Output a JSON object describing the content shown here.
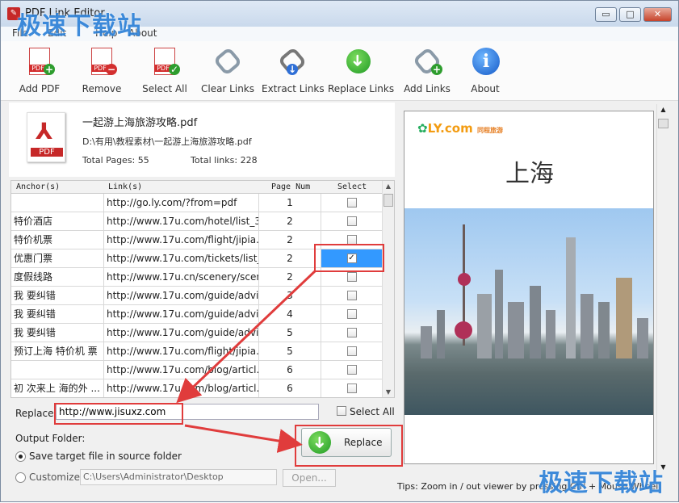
{
  "window": {
    "title": "PDF Link Editor",
    "controls": {
      "minimize": "▭",
      "maximize": "□",
      "close": "✕"
    }
  },
  "watermark": {
    "top": "极速下载站",
    "bottom": "极速下载站"
  },
  "menu": {
    "items": [
      "File",
      "Edit",
      "Help",
      "About"
    ]
  },
  "toolbar": {
    "items": [
      {
        "label": "Add PDF",
        "icon": "add-pdf-icon"
      },
      {
        "label": "Remove",
        "icon": "remove-pdf-icon"
      },
      {
        "label": "Select All",
        "icon": "select-all-icon"
      },
      {
        "label": "Clear Links",
        "icon": "clear-links-icon"
      },
      {
        "label": "Extract Links",
        "icon": "extract-links-icon"
      },
      {
        "label": "Replace Links",
        "icon": "replace-links-icon"
      },
      {
        "label": "Add Links",
        "icon": "add-links-icon"
      },
      {
        "label": "About",
        "icon": "info-icon"
      }
    ]
  },
  "file": {
    "name": "一起游上海旅游攻略.pdf",
    "path": "D:\\有用\\教程素材\\一起游上海旅游攻略.pdf",
    "total_pages": "Total Pages: 55",
    "total_links": "Total links: 228"
  },
  "table": {
    "headers": [
      "Anchor(s)",
      "Link(s)",
      "Page Num",
      "Select"
    ],
    "rows": [
      {
        "anchor": "",
        "link": "http://go.ly.com/?from=pdf",
        "page": "1",
        "selected": false
      },
      {
        "anchor": "特价酒店",
        "link": "http://www.17u.com/hotel/list_3...",
        "page": "2",
        "selected": false
      },
      {
        "anchor": "特价机票",
        "link": "http://www.17u.com/flight/jipia...",
        "page": "2",
        "selected": false
      },
      {
        "anchor": "优惠门票",
        "link": "http://www.17u.com/tickets/list_...",
        "page": "2",
        "selected": true
      },
      {
        "anchor": "度假线路",
        "link": "http://www.17u.cn/scenery/scen...",
        "page": "2",
        "selected": false
      },
      {
        "anchor": "我 要纠错",
        "link": "http://www.17u.com/guide/advi...",
        "page": "3",
        "selected": false
      },
      {
        "anchor": "我 要纠错",
        "link": "http://www.17u.com/guide/advi...",
        "page": "4",
        "selected": false
      },
      {
        "anchor": "我 要纠错",
        "link": "http://www.17u.com/guide/advi...",
        "page": "5",
        "selected": false
      },
      {
        "anchor": "预订上海 特价机 票",
        "link": "http://www.17u.com/flight/jipia...",
        "page": "5",
        "selected": false
      },
      {
        "anchor": "",
        "link": "http://www.17u.com/blog/articl...",
        "page": "6",
        "selected": false
      },
      {
        "anchor": "初 次来上 海的外 ...",
        "link": "http://www.17u.com/blog/articl...",
        "page": "6",
        "selected": false
      }
    ]
  },
  "replace": {
    "label": "Replace:",
    "value": "http://www.jisuxz.com",
    "select_all": "Select All",
    "button": "Replace"
  },
  "output": {
    "label": "Output Folder:",
    "option_source": "Save target file in source folder",
    "option_custom": "Customize:",
    "custom_path": "C:\\Users\\Administrator\\Desktop",
    "open_button": "Open..."
  },
  "preview": {
    "logo": "LY.com",
    "logo_small": "同程旅游",
    "title": "上海"
  },
  "tips": "Tips: Zoom in / out viewer by pressing Ctrl + Mouse Wheel",
  "colors": {
    "accent": "#3399ff",
    "highlight": "#e03c3c",
    "watermark": "#2f82d8"
  }
}
